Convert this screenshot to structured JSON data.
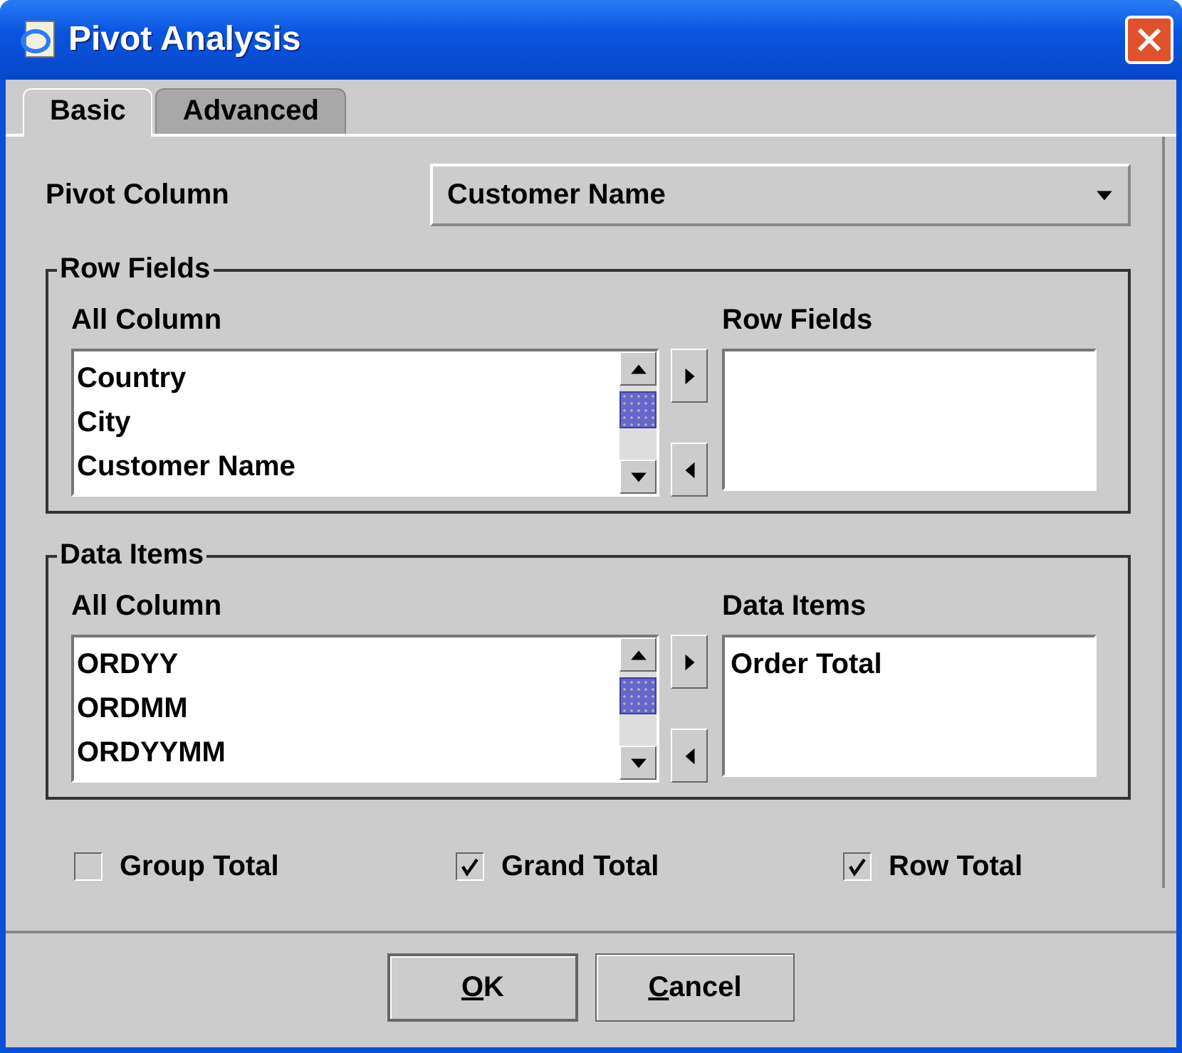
{
  "window": {
    "title": "Pivot Analysis"
  },
  "tabs": [
    {
      "label": "Basic",
      "selected": true
    },
    {
      "label": "Advanced",
      "selected": false
    }
  ],
  "pivot_column": {
    "label": "Pivot Column",
    "value": "Customer Name"
  },
  "groups": [
    {
      "title": "Row Fields",
      "left_label": "All Column",
      "right_label": "Row Fields",
      "available": [
        "Country",
        "City",
        "Customer Name"
      ]
    },
    {
      "title": "Data Items",
      "left_label": "All Column",
      "right_label": "Data Items",
      "available": [
        "ORDYY",
        "ORDMM",
        "ORDYYMM"
      ],
      "chosen": [
        "Order Total"
      ]
    }
  ],
  "options": [
    {
      "label": "Group Total",
      "checked": false
    },
    {
      "label": "Grand Total",
      "checked": true
    },
    {
      "label": "Row Total",
      "checked": true
    }
  ],
  "buttons": [
    {
      "label": "OK",
      "first_letter_underlined": true,
      "default": true
    },
    {
      "label": "Cancel",
      "first_letter_underlined": true,
      "default": false
    }
  ]
}
